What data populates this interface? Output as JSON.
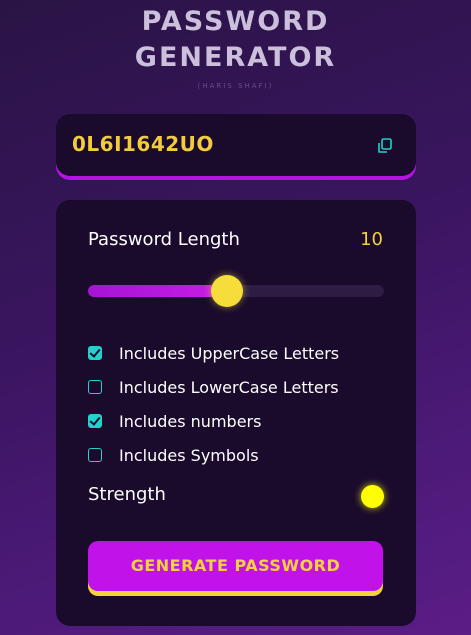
{
  "header": {
    "title_line1": "PASSWORD",
    "title_line2": "GENERATOR",
    "subtitle": "(HARIS SHAFI)"
  },
  "display": {
    "password": "0L6I1642UO",
    "copy_icon": "copy-icon"
  },
  "length": {
    "label": "Password Length",
    "value": "10",
    "slider_fraction": 0.47
  },
  "options": [
    {
      "label": "Includes UpperCase Letters",
      "checked": true
    },
    {
      "label": "Includes LowerCase Letters",
      "checked": false
    },
    {
      "label": "Includes numbers",
      "checked": true
    },
    {
      "label": "Includes Symbols",
      "checked": false
    }
  ],
  "strength": {
    "label": "Strength",
    "indicator_color": "#ffff00"
  },
  "generate_button": {
    "label": "GENERATE PASSWORD"
  },
  "colors": {
    "accent_yellow": "#f3d23c",
    "accent_purple": "#c212ea",
    "checkbox_teal": "#20d4cc",
    "card_background": "#1a0a2c"
  }
}
